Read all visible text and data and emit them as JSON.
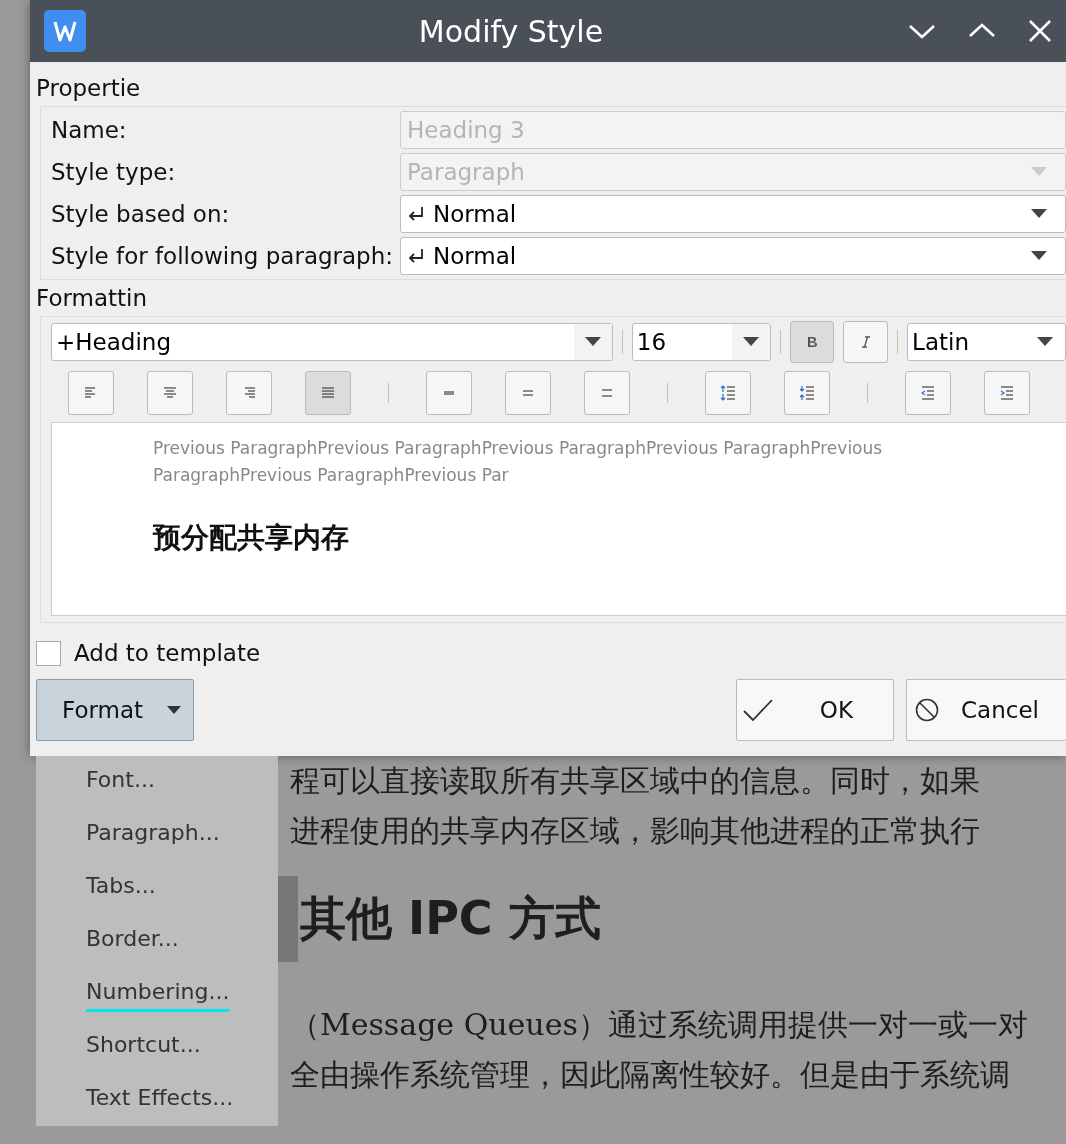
{
  "document": {
    "lines_before": [
      "程可以直接读取所有共享区域中的信息。同时，如果",
      "进程使用的共享内存区域，影响其他进程的正常执行"
    ],
    "heading": {
      "text": "其他  IPC  方式"
    },
    "lines_after": [
      "（Message Queues）通过系统调用提供一对一或一对",
      "全由操作系统管理，因此隔离性较好。但是由于系统调"
    ]
  },
  "window": {
    "title": "Modify Style"
  },
  "properties": {
    "heading": "Propertie",
    "rows": [
      {
        "label": "Name:",
        "kind": "text",
        "value": "Heading 3",
        "disabled": true,
        "paragraph_mark": false
      },
      {
        "label": "Style type:",
        "kind": "dropdown",
        "value": "Paragraph",
        "disabled": true,
        "paragraph_mark": false
      },
      {
        "label": "Style based on:",
        "kind": "dropdown",
        "value": "Normal",
        "disabled": false,
        "paragraph_mark": true
      },
      {
        "label": "Style for following paragraph:",
        "kind": "dropdown",
        "value": "Normal",
        "disabled": false,
        "paragraph_mark": true
      }
    ]
  },
  "formatting": {
    "heading": "Formattin",
    "font": "+Heading",
    "size": "16",
    "bold": true,
    "italic": false,
    "script": "Latin",
    "tool_groups": [
      [
        {
          "kind": "align-left",
          "selected": false
        },
        {
          "kind": "align-center",
          "selected": false
        },
        {
          "kind": "align-right",
          "selected": false
        },
        {
          "kind": "justify",
          "selected": true
        }
      ],
      [
        {
          "kind": "single-spacing",
          "selected": false
        },
        {
          "kind": "one-half-spacing",
          "selected": false
        },
        {
          "kind": "double-spacing",
          "selected": false
        }
      ],
      [
        {
          "kind": "increase-spacing",
          "selected": false
        },
        {
          "kind": "decrease-spacing",
          "selected": false
        }
      ],
      [
        {
          "kind": "decrease-indent",
          "selected": false
        },
        {
          "kind": "increase-indent",
          "selected": false
        }
      ]
    ]
  },
  "preview": {
    "previous": "Previous ParagraphPrevious ParagraphPrevious ParagraphPrevious ParagraphPrevious ParagraphPrevious ParagraphPrevious Par",
    "sample": "预分配共享内存"
  },
  "add_to_template": {
    "label": "Add to template",
    "checked": false
  },
  "buttons": {
    "format": {
      "label": "Format",
      "pressed": true
    },
    "ok": "OK",
    "cancel": "Cancel"
  },
  "format_menu": [
    {
      "label": "Font...",
      "selected": false
    },
    {
      "label": "Paragraph...",
      "selected": false
    },
    {
      "label": "Tabs...",
      "selected": false
    },
    {
      "label": "Border...",
      "selected": false
    },
    {
      "label": "Numbering...",
      "selected": true
    },
    {
      "label": "Shortcut...",
      "selected": false
    },
    {
      "label": "Text Effects...",
      "selected": false
    }
  ]
}
